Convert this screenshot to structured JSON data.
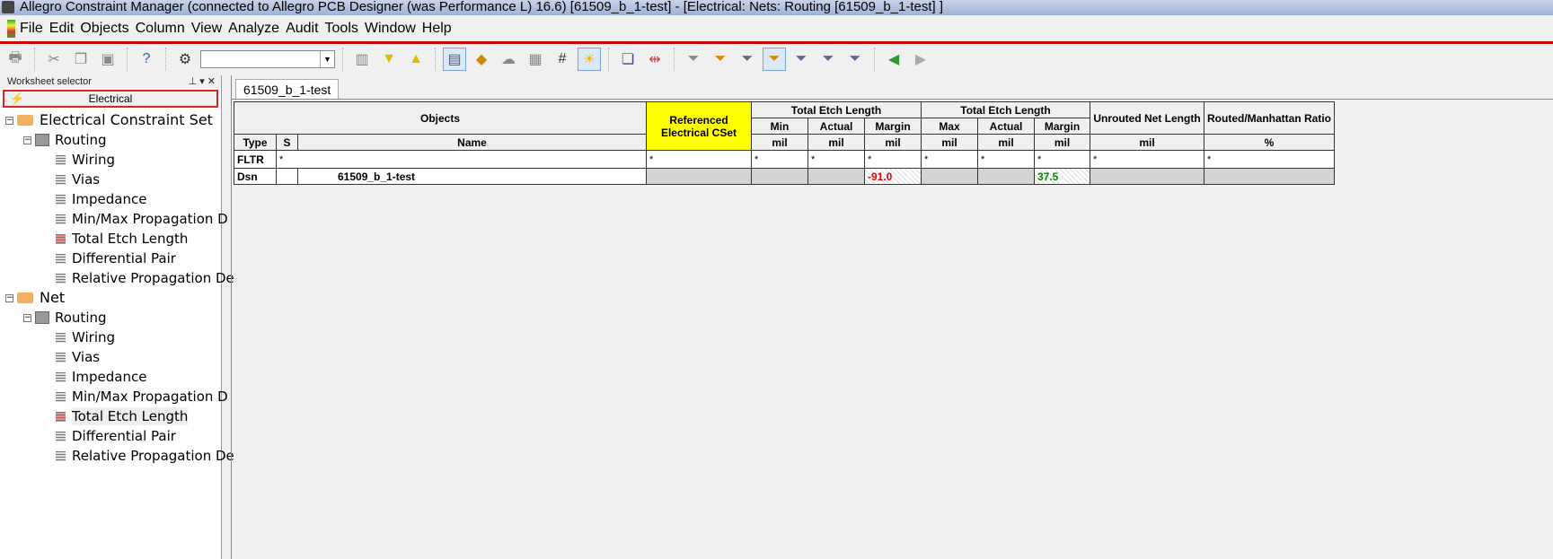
{
  "window": {
    "title": "Allegro Constraint Manager (connected to Allegro PCB Designer (was Performance L) 16.6) [61509_b_1-test] - [Electrical:  Nets:  Routing [61509_b_1-test] ]"
  },
  "menu": [
    "File",
    "Edit",
    "Objects",
    "Column",
    "View",
    "Analyze",
    "Audit",
    "Tools",
    "Window",
    "Help"
  ],
  "toolbar": {
    "combo_value": ""
  },
  "sidebar": {
    "title": "Worksheet selector",
    "domain_button": "Electrical",
    "tree": [
      {
        "label": "Electrical Constraint Set",
        "children": [
          {
            "label": "Routing",
            "children": [
              "Wiring",
              "Vias",
              "Impedance",
              "Min/Max Propagation D",
              "Total Etch Length",
              "Differential Pair",
              "Relative Propagation De"
            ]
          }
        ]
      },
      {
        "label": "Net",
        "children": [
          {
            "label": "Routing",
            "children": [
              "Wiring",
              "Vias",
              "Impedance",
              "Min/Max Propagation D",
              "Total Etch Length",
              "Differential Pair",
              "Relative Propagation De"
            ]
          }
        ]
      }
    ],
    "selected": "Net/Routing/Total Etch Length"
  },
  "tab": "61509_b_1-test",
  "grid": {
    "h_objects": "Objects",
    "h_refcset": "Referenced Electrical CSet",
    "h_tel1": "Total Etch Length",
    "h_tel2": "Total Etch Length",
    "h_unrouted": "Unrouted Net Length",
    "h_ratio": "Routed/Manhattan Ratio",
    "sub": [
      "Min",
      "Actual",
      "Margin",
      "Max",
      "Actual",
      "Margin"
    ],
    "type": "Type",
    "s": "S",
    "name": "Name",
    "units": [
      "mil",
      "mil",
      "mil",
      "mil",
      "mil",
      "mil",
      "mil",
      "%"
    ],
    "filter_label": "FLTR",
    "filter": "*",
    "row": {
      "type": "Dsn",
      "name": "61509_b_1-test",
      "min_margin": "-91.0",
      "max_margin": "37.5"
    }
  }
}
